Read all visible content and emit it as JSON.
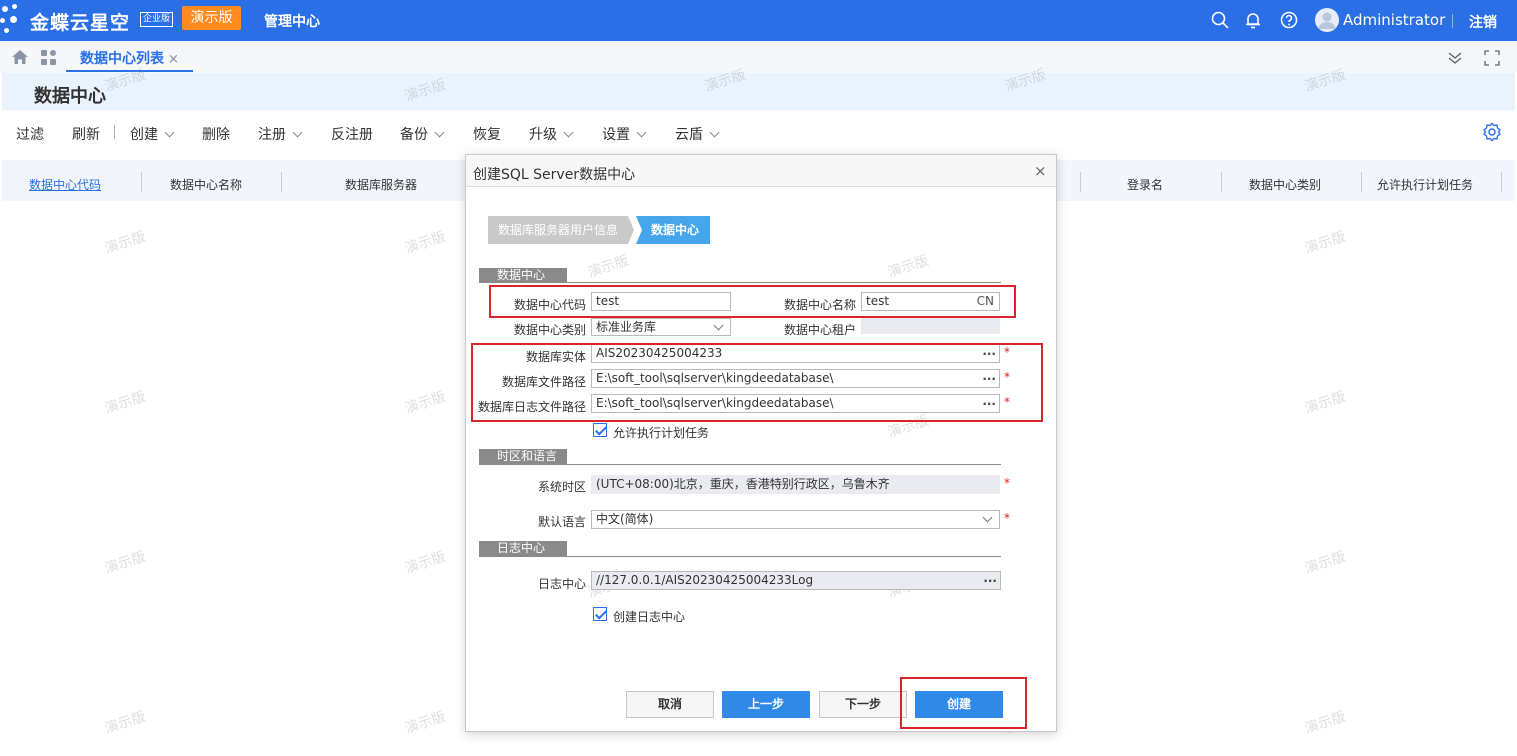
{
  "header": {
    "brand": "金蝶云星空",
    "brand_edition": "企业版",
    "demo_badge": "演示版",
    "mgmt_center": "管理中心",
    "user": "Administrator",
    "logout": "注销"
  },
  "tabs": {
    "active_label": "数据中心列表",
    "close_glyph": "×"
  },
  "page": {
    "title": "数据中心",
    "watermark": "演示版"
  },
  "toolbar": {
    "filter": "过滤",
    "refresh": "刷新",
    "create": "创建",
    "delete": "删除",
    "register": "注册",
    "unregister": "反注册",
    "backup": "备份",
    "restore": "恢复",
    "upgrade": "升级",
    "settings": "设置",
    "cloud_shield": "云盾"
  },
  "grid": {
    "columns": [
      "数据中心代码",
      "数据中心名称",
      "数据库服务器",
      "登录名",
      "数据中心类别",
      "允许执行计划任务"
    ]
  },
  "dialog": {
    "title": "创建SQL Server数据中心",
    "close_glyph": "×",
    "steps": [
      "数据库服务器用户信息",
      "数据中心"
    ],
    "section_datacenter": "数据中心",
    "dc_code_label": "数据中心代码",
    "dc_code_value": "test",
    "dc_name_label": "数据中心名称",
    "dc_name_value": "test",
    "dc_name_lang": "CN",
    "dc_type_label": "数据中心类别",
    "dc_type_value": "标准业务库",
    "dc_tenant_label": "数据中心租户",
    "db_instance_label": "数据库实体",
    "db_instance_value": "AIS20230425004233",
    "db_file_path_label": "数据库文件路径",
    "db_file_path_value": "E:\\soft_tool\\sqlserver\\kingdeedatabase\\",
    "db_log_path_label": "数据库日志文件路径",
    "db_log_path_value": "E:\\soft_tool\\sqlserver\\kingdeedatabase\\",
    "allow_schedule_label": "允许执行计划任务",
    "section_timezone": "时区和语言",
    "timezone_label": "系统时区",
    "timezone_value": "(UTC+08:00)北京，重庆，香港特别行政区，乌鲁木齐",
    "language_label": "默认语言",
    "language_value": "中文(简体)",
    "section_logcenter": "日志中心",
    "logcenter_label": "日志中心",
    "logcenter_value": "//127.0.0.1/AIS20230425004233Log",
    "create_logcenter_label": "创建日志中心",
    "ellipsis": "...",
    "required_mark": "*",
    "btn_cancel": "取消",
    "btn_prev": "上一步",
    "btn_next": "下一步",
    "btn_create": "创建"
  },
  "colors": {
    "header_blue": "#2a6fe6",
    "demo_orange": "#ff8a1f",
    "step_active": "#45a6ec",
    "primary_button": "#2e8ae6",
    "highlight_red": "#d9252a"
  }
}
